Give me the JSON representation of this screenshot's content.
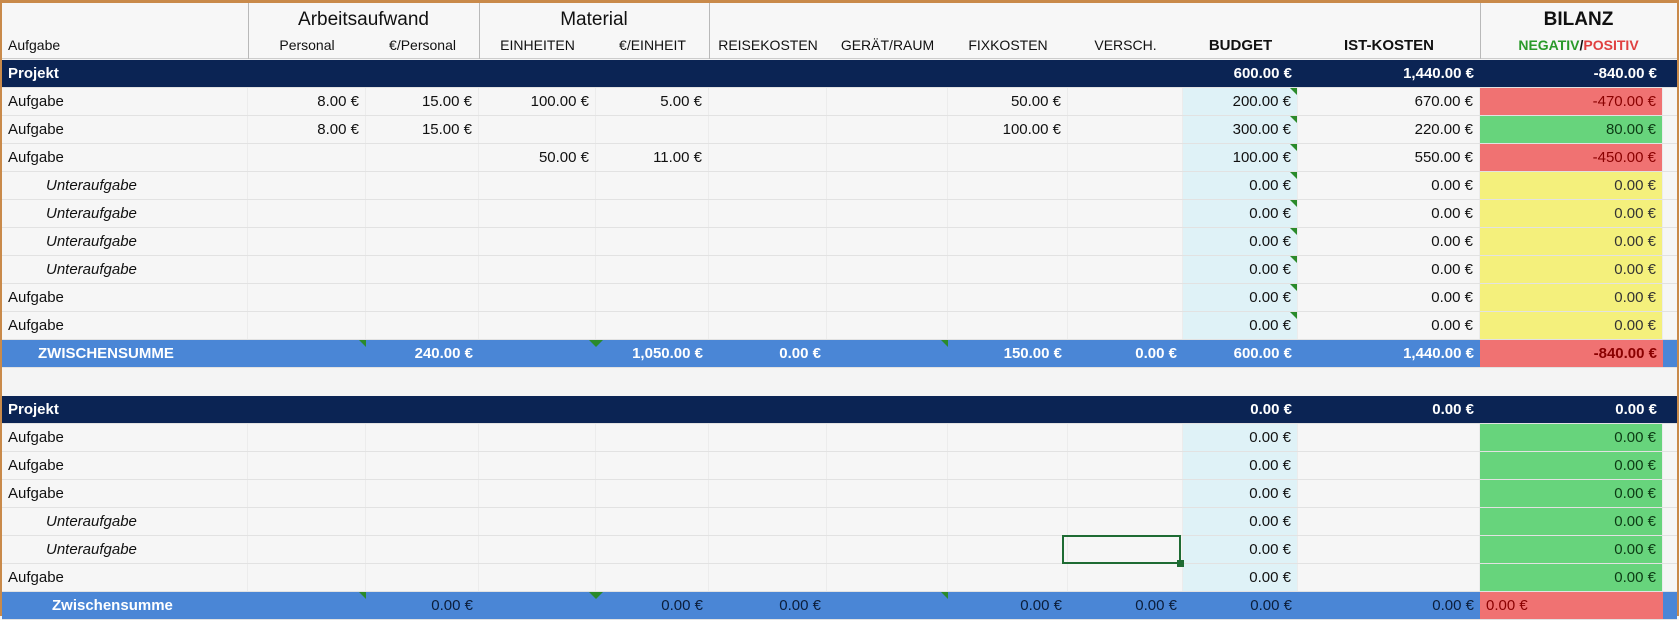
{
  "header": {
    "task": "Aufgabe",
    "group_work": "Arbeitsaufwand",
    "group_material": "Material",
    "bilanz": "BILANZ",
    "bilanz_neg": "NEGATIV",
    "bilanz_sep": "/",
    "bilanz_pos": "POSITIV",
    "columns": [
      "Personal",
      "€/Personal",
      "EINHEITEN",
      "€/EINHEIT",
      "REISEKOSTEN",
      "GERÄT/RAUM",
      "FIXKOSTEN",
      "VERSCH.",
      "BUDGET",
      "IST-KOSTEN"
    ]
  },
  "colors": {
    "navy": "#0b2454",
    "subtotal": "#4a86d6",
    "negative": "#f07272",
    "positive": "#67d47c",
    "zero": "#f4f07c",
    "neg_label": "#2a9a2a",
    "pos_label": "#e04040"
  },
  "sections": [
    {
      "project": {
        "label": "Projekt",
        "budget": "600.00 €",
        "ist": "1,440.00 €",
        "bilanz": "-840.00 €"
      },
      "rows": [
        {
          "label": "Aufgabe",
          "indent": false,
          "cells": [
            "8.00 €",
            "15.00 €",
            "100.00 €",
            "5.00 €",
            "",
            "",
            "50.00 €",
            "",
            "200.00 €",
            "670.00 €"
          ],
          "bilanz": "-470.00 €",
          "status": "neg"
        },
        {
          "label": "Aufgabe",
          "indent": false,
          "cells": [
            "8.00 €",
            "15.00 €",
            "",
            "",
            "",
            "",
            "100.00 €",
            "",
            "300.00 €",
            "220.00 €"
          ],
          "bilanz": "80.00 €",
          "status": "pos"
        },
        {
          "label": "Aufgabe",
          "indent": false,
          "cells": [
            "",
            "",
            "50.00 €",
            "11.00 €",
            "",
            "",
            "",
            "",
            "100.00 €",
            "550.00 €"
          ],
          "bilanz": "-450.00 €",
          "status": "neg"
        },
        {
          "label": "Unteraufgabe",
          "indent": true,
          "cells": [
            "",
            "",
            "",
            "",
            "",
            "",
            "",
            "",
            "0.00 €",
            "0.00 €"
          ],
          "bilanz": "0.00 €",
          "status": "zero"
        },
        {
          "label": "Unteraufgabe",
          "indent": true,
          "cells": [
            "",
            "",
            "",
            "",
            "",
            "",
            "",
            "",
            "0.00 €",
            "0.00 €"
          ],
          "bilanz": "0.00 €",
          "status": "zero"
        },
        {
          "label": "Unteraufgabe",
          "indent": true,
          "cells": [
            "",
            "",
            "",
            "",
            "",
            "",
            "",
            "",
            "0.00 €",
            "0.00 €"
          ],
          "bilanz": "0.00 €",
          "status": "zero"
        },
        {
          "label": "Unteraufgabe",
          "indent": true,
          "cells": [
            "",
            "",
            "",
            "",
            "",
            "",
            "",
            "",
            "0.00 €",
            "0.00 €"
          ],
          "bilanz": "0.00 €",
          "status": "zero"
        },
        {
          "label": "Aufgabe",
          "indent": false,
          "cells": [
            "",
            "",
            "",
            "",
            "",
            "",
            "",
            "",
            "0.00 €",
            "0.00 €"
          ],
          "bilanz": "0.00 €",
          "status": "zero"
        },
        {
          "label": "Aufgabe",
          "indent": false,
          "cells": [
            "",
            "",
            "",
            "",
            "",
            "",
            "",
            "",
            "0.00 €",
            "0.00 €"
          ],
          "bilanz": "0.00 €",
          "status": "zero"
        }
      ],
      "subtotal": {
        "label": "ZWISCHENSUMME",
        "cells": [
          "",
          "240.00 €",
          "",
          "1,050.00 €",
          "0.00 €",
          "",
          "150.00 €",
          "0.00 €",
          "600.00 €",
          "1,440.00 €"
        ],
        "bilanz": "-840.00 €",
        "status": "neg"
      }
    },
    {
      "project": {
        "label": "Projekt",
        "budget": "0.00 €",
        "ist": "0.00 €",
        "bilanz": "0.00 €"
      },
      "rows": [
        {
          "label": "Aufgabe",
          "indent": false,
          "cells": [
            "",
            "",
            "",
            "",
            "",
            "",
            "",
            "",
            "0.00 €",
            ""
          ],
          "bilanz": "0.00 €",
          "status": "pos"
        },
        {
          "label": "Aufgabe",
          "indent": false,
          "cells": [
            "",
            "",
            "",
            "",
            "",
            "",
            "",
            "",
            "0.00 €",
            ""
          ],
          "bilanz": "0.00 €",
          "status": "pos"
        },
        {
          "label": "Aufgabe",
          "indent": false,
          "cells": [
            "",
            "",
            "",
            "",
            "",
            "",
            "",
            "",
            "0.00 €",
            ""
          ],
          "bilanz": "0.00 €",
          "status": "pos"
        },
        {
          "label": "Unteraufgabe",
          "indent": true,
          "cells": [
            "",
            "",
            "",
            "",
            "",
            "",
            "",
            "",
            "0.00 €",
            ""
          ],
          "bilanz": "0.00 €",
          "status": "pos"
        },
        {
          "label": "Unteraufgabe",
          "indent": true,
          "cells": [
            "",
            "",
            "",
            "",
            "",
            "",
            "",
            "",
            "0.00 €",
            ""
          ],
          "bilanz": "0.00 €",
          "status": "pos"
        },
        {
          "label": "Aufgabe",
          "indent": false,
          "cells": [
            "",
            "",
            "",
            "",
            "",
            "",
            "",
            "",
            "0.00 €",
            ""
          ],
          "bilanz": "0.00 €",
          "status": "pos"
        }
      ],
      "subtotal": {
        "label": "Zwischensumme",
        "cells": [
          "",
          "0.00 €",
          "",
          "0.00 €",
          "0.00 €",
          "",
          "0.00 €",
          "0.00 €",
          "0.00 €",
          "0.00 €"
        ],
        "bilanz": "0.00 €",
        "status": "neg"
      }
    }
  ]
}
